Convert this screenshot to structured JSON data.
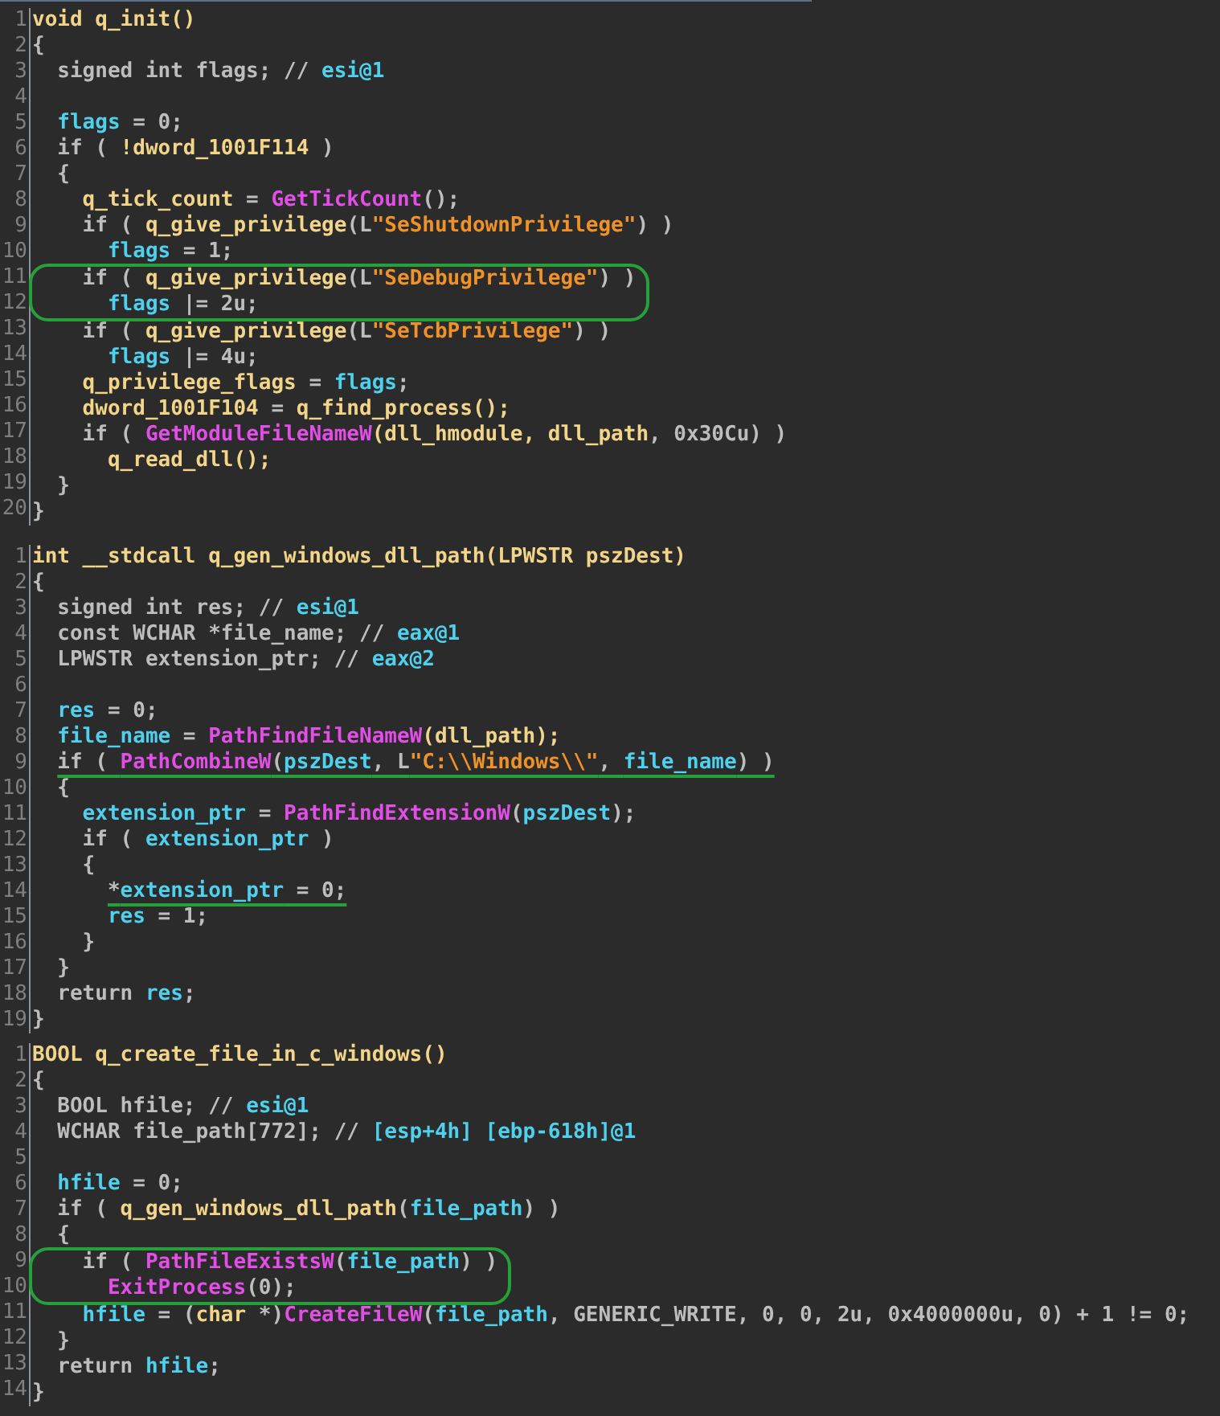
{
  "panels": [
    {
      "lines": [
        {
          "number": "1",
          "tokens": [
            {
              "text": "void q_init()",
              "kind": "fn"
            }
          ]
        },
        {
          "number": "2",
          "tokens": [
            {
              "text": "{",
              "kind": "kw"
            }
          ]
        },
        {
          "number": "3",
          "tokens": [
            {
              "text": "  signed int flags; // ",
              "kind": "kw"
            },
            {
              "text": "esi@1",
              "kind": "var"
            }
          ]
        },
        {
          "number": "4"
        },
        {
          "number": "5",
          "tokens": [
            {
              "text": "  flags",
              "kind": "var"
            },
            {
              "text": " = 0;",
              "kind": "kw"
            }
          ]
        },
        {
          "number": "6",
          "tokens": [
            {
              "text": "  if ( ",
              "kind": "kw"
            },
            {
              "text": "!dword_1001F114",
              "kind": "fn"
            },
            {
              "text": " )",
              "kind": "kw"
            }
          ]
        },
        {
          "number": "7",
          "tokens": [
            {
              "text": "  {",
              "kind": "kw"
            }
          ]
        },
        {
          "number": "8",
          "tokens": [
            {
              "text": "    q_tick_count",
              "kind": "fn"
            },
            {
              "text": " = ",
              "kind": "kw"
            },
            {
              "text": "GetTickCount",
              "kind": "api"
            },
            {
              "text": "();",
              "kind": "kw"
            }
          ]
        },
        {
          "number": "9",
          "tokens": [
            {
              "text": "    if ( ",
              "kind": "kw"
            },
            {
              "text": "q_give_privilege",
              "kind": "fn"
            },
            {
              "text": "(L",
              "kind": "kw"
            },
            {
              "text": "\"SeShutdownPrivilege\"",
              "kind": "str"
            },
            {
              "text": ") )",
              "kind": "kw"
            }
          ]
        },
        {
          "number": "10",
          "tokens": [
            {
              "text": "      flags",
              "kind": "var"
            },
            {
              "text": " = 1;",
              "kind": "kw"
            }
          ]
        },
        {
          "number": "11",
          "circled": true,
          "tokens": [
            {
              "text": "    if ( ",
              "kind": "kw"
            },
            {
              "text": "q_give_privilege",
              "kind": "fn"
            },
            {
              "text": "(L",
              "kind": "kw"
            },
            {
              "text": "\"SeDebugPrivilege\"",
              "kind": "str"
            },
            {
              "text": ") )",
              "kind": "kw"
            }
          ]
        },
        {
          "number": "12",
          "circled": true,
          "tokens": [
            {
              "text": "      flags",
              "kind": "var"
            },
            {
              "text": " |= 2u;",
              "kind": "kw"
            }
          ]
        },
        {
          "number": "13",
          "tokens": [
            {
              "text": "    if ( ",
              "kind": "kw"
            },
            {
              "text": "q_give_privilege",
              "kind": "fn"
            },
            {
              "text": "(L",
              "kind": "kw"
            },
            {
              "text": "\"SeTcbPrivilege\"",
              "kind": "str"
            },
            {
              "text": ") )",
              "kind": "kw"
            }
          ]
        },
        {
          "number": "14",
          "tokens": [
            {
              "text": "      flags",
              "kind": "var"
            },
            {
              "text": " |= 4u;",
              "kind": "kw"
            }
          ]
        },
        {
          "number": "15",
          "tokens": [
            {
              "text": "    q_privilege_flags",
              "kind": "fn"
            },
            {
              "text": " = ",
              "kind": "kw"
            },
            {
              "text": "flags",
              "kind": "var"
            },
            {
              "text": ";",
              "kind": "kw"
            }
          ]
        },
        {
          "number": "16",
          "tokens": [
            {
              "text": "    dword_1001F104",
              "kind": "fn"
            },
            {
              "text": " = ",
              "kind": "kw"
            },
            {
              "text": "q_find_process();",
              "kind": "fn"
            }
          ]
        },
        {
          "number": "17",
          "tokens": [
            {
              "text": "    if ( ",
              "kind": "kw"
            },
            {
              "text": "GetModuleFileNameW",
              "kind": "api"
            },
            {
              "text": "(dll_hmodule, dll_path",
              "kind": "fn"
            },
            {
              "text": ", 0x30Cu) )",
              "kind": "kw"
            }
          ]
        },
        {
          "number": "18",
          "tokens": [
            {
              "text": "      q_read_dll();",
              "kind": "fn"
            }
          ]
        },
        {
          "number": "19",
          "tokens": [
            {
              "text": "  }",
              "kind": "kw"
            }
          ]
        },
        {
          "number": "20",
          "tokens": [
            {
              "text": "}",
              "kind": "kw"
            }
          ]
        }
      ]
    },
    {
      "lines": [
        {
          "number": "1",
          "tokens": [
            {
              "text": "int __stdcall q_gen_windows_dll_path(LPWSTR pszDest)",
              "kind": "fn"
            }
          ]
        },
        {
          "number": "2",
          "tokens": [
            {
              "text": "{",
              "kind": "kw"
            }
          ]
        },
        {
          "number": "3",
          "tokens": [
            {
              "text": "  signed int res; // ",
              "kind": "kw"
            },
            {
              "text": "esi@1",
              "kind": "var"
            }
          ]
        },
        {
          "number": "4",
          "tokens": [
            {
              "text": "  const WCHAR *file_name; // ",
              "kind": "kw"
            },
            {
              "text": "eax@1",
              "kind": "var"
            }
          ]
        },
        {
          "number": "5",
          "tokens": [
            {
              "text": "  LPWSTR extension_ptr; // ",
              "kind": "kw"
            },
            {
              "text": "eax@2",
              "kind": "var"
            }
          ]
        },
        {
          "number": "6"
        },
        {
          "number": "7",
          "tokens": [
            {
              "text": "  res",
              "kind": "var"
            },
            {
              "text": " = 0;",
              "kind": "kw"
            }
          ]
        },
        {
          "number": "8",
          "tokens": [
            {
              "text": "  file_name",
              "kind": "var"
            },
            {
              "text": " = ",
              "kind": "kw"
            },
            {
              "text": "PathFindFileNameW",
              "kind": "api"
            },
            {
              "text": "(dll_path);",
              "kind": "fn"
            }
          ]
        },
        {
          "number": "9",
          "underlined": true,
          "tokens": [
            {
              "text": "  if ( ",
              "kind": "kw"
            },
            {
              "text": "PathCombineW",
              "kind": "api"
            },
            {
              "text": "(",
              "kind": "kw"
            },
            {
              "text": "pszDest",
              "kind": "var"
            },
            {
              "text": ", L",
              "kind": "kw"
            },
            {
              "text": "\"C:\\\\Windows\\\\\"",
              "kind": "str"
            },
            {
              "text": ", ",
              "kind": "kw"
            },
            {
              "text": "file_name",
              "kind": "var"
            },
            {
              "text": ") )",
              "kind": "kw"
            }
          ]
        },
        {
          "number": "10",
          "tokens": [
            {
              "text": "  {",
              "kind": "kw"
            }
          ]
        },
        {
          "number": "11",
          "tokens": [
            {
              "text": "    extension_ptr",
              "kind": "var"
            },
            {
              "text": " = ",
              "kind": "kw"
            },
            {
              "text": "PathFindExtensionW",
              "kind": "api"
            },
            {
              "text": "(",
              "kind": "kw"
            },
            {
              "text": "pszDest",
              "kind": "var"
            },
            {
              "text": ");",
              "kind": "kw"
            }
          ]
        },
        {
          "number": "12",
          "tokens": [
            {
              "text": "    if ( ",
              "kind": "kw"
            },
            {
              "text": "extension_ptr",
              "kind": "var"
            },
            {
              "text": " )",
              "kind": "kw"
            }
          ]
        },
        {
          "number": "13",
          "tokens": [
            {
              "text": "    {",
              "kind": "kw"
            }
          ]
        },
        {
          "number": "14",
          "underlined": true,
          "tokens": [
            {
              "text": "      *",
              "kind": "kw"
            },
            {
              "text": "extension_ptr",
              "kind": "var"
            },
            {
              "text": " = 0;",
              "kind": "kw"
            }
          ]
        },
        {
          "number": "15",
          "tokens": [
            {
              "text": "      res",
              "kind": "var"
            },
            {
              "text": " = 1;",
              "kind": "kw"
            }
          ]
        },
        {
          "number": "16",
          "tokens": [
            {
              "text": "    }",
              "kind": "kw"
            }
          ]
        },
        {
          "number": "17",
          "tokens": [
            {
              "text": "  }",
              "kind": "kw"
            }
          ]
        },
        {
          "number": "18",
          "tokens": [
            {
              "text": "  return ",
              "kind": "kw"
            },
            {
              "text": "res",
              "kind": "var"
            },
            {
              "text": ";",
              "kind": "kw"
            }
          ]
        },
        {
          "number": "19",
          "tokens": [
            {
              "text": "}",
              "kind": "kw"
            }
          ]
        }
      ]
    },
    {
      "lines": [
        {
          "number": "1",
          "tokens": [
            {
              "text": "BOOL q_create_file_in_c_windows()",
              "kind": "fn"
            }
          ]
        },
        {
          "number": "2",
          "tokens": [
            {
              "text": "{",
              "kind": "kw"
            }
          ]
        },
        {
          "number": "3",
          "tokens": [
            {
              "text": "  BOOL hfile; // ",
              "kind": "kw"
            },
            {
              "text": "esi@1",
              "kind": "var"
            }
          ]
        },
        {
          "number": "4",
          "tokens": [
            {
              "text": "  WCHAR file_path[772]; // ",
              "kind": "kw"
            },
            {
              "text": "[esp+4h] [ebp-618h]@1",
              "kind": "var"
            }
          ]
        },
        {
          "number": "5"
        },
        {
          "number": "6",
          "tokens": [
            {
              "text": "  hfile",
              "kind": "var"
            },
            {
              "text": " = 0;",
              "kind": "kw"
            }
          ]
        },
        {
          "number": "7",
          "tokens": [
            {
              "text": "  if ( ",
              "kind": "kw"
            },
            {
              "text": "q_gen_windows_dll_path",
              "kind": "fn"
            },
            {
              "text": "(",
              "kind": "kw"
            },
            {
              "text": "file_path",
              "kind": "var"
            },
            {
              "text": ") )",
              "kind": "kw"
            }
          ]
        },
        {
          "number": "8",
          "tokens": [
            {
              "text": "  {",
              "kind": "kw"
            }
          ]
        },
        {
          "number": "9",
          "circled": true,
          "tokens": [
            {
              "text": "    if ( ",
              "kind": "kw"
            },
            {
              "text": "PathFileExistsW",
              "kind": "api"
            },
            {
              "text": "(",
              "kind": "kw"
            },
            {
              "text": "file_path",
              "kind": "var"
            },
            {
              "text": ") )",
              "kind": "kw"
            }
          ]
        },
        {
          "number": "10",
          "circled": true,
          "tokens": [
            {
              "text": "      ExitProcess",
              "kind": "api"
            },
            {
              "text": "(0);",
              "kind": "kw"
            }
          ]
        },
        {
          "number": "11",
          "tokens": [
            {
              "text": "    hfile",
              "kind": "var"
            },
            {
              "text": " = (",
              "kind": "kw"
            },
            {
              "text": "char",
              "kind": "fn"
            },
            {
              "text": " *)",
              "kind": "kw"
            },
            {
              "text": "CreateFileW",
              "kind": "api"
            },
            {
              "text": "(",
              "kind": "kw"
            },
            {
              "text": "file_path",
              "kind": "var"
            },
            {
              "text": ", GENERIC_WRITE, 0, 0, 2u, 0x4000000u, 0) + 1 != 0;",
              "kind": "kw"
            }
          ]
        },
        {
          "number": "12",
          "tokens": [
            {
              "text": "  }",
              "kind": "kw"
            }
          ]
        },
        {
          "number": "13",
          "tokens": [
            {
              "text": "  return ",
              "kind": "kw"
            },
            {
              "text": "hfile",
              "kind": "var"
            },
            {
              "text": ";",
              "kind": "kw"
            }
          ]
        },
        {
          "number": "14",
          "tokens": [
            {
              "text": "}",
              "kind": "kw"
            }
          ]
        }
      ]
    }
  ]
}
